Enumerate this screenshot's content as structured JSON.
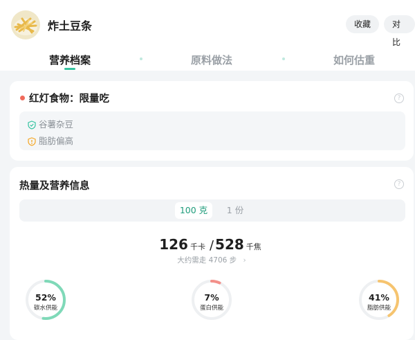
{
  "header": {
    "title": "炸土豆条",
    "actions": {
      "favorite": "收藏",
      "compare": "对比"
    }
  },
  "tabs": [
    {
      "label": "营养档案",
      "active": true
    },
    {
      "label": "原料做法",
      "active": false
    },
    {
      "label": "如何估重",
      "active": false
    }
  ],
  "rating": {
    "title": "红灯食物：限量吃",
    "color": "#f06a5b",
    "tags": [
      {
        "text": "谷薯杂豆",
        "icon": "shield-check-icon",
        "color": "#35c3a0"
      },
      {
        "text": "脂肪偏高",
        "icon": "shield-alert-icon",
        "color": "#f5a623"
      }
    ]
  },
  "nutrition": {
    "title": "热量及营养信息",
    "portions": [
      "100 克",
      "1 份"
    ],
    "selected_portion": "100 克",
    "kcal_value": "126",
    "kcal_unit": "千卡",
    "separator": "/",
    "kj_value": "528",
    "kj_unit": "千焦",
    "walk_text": "大约需走 4706 步",
    "macros": [
      {
        "pct": "52%",
        "value": 0.52,
        "label": "碳水供能",
        "color": "#7fd9b8"
      },
      {
        "pct": "7%",
        "value": 0.07,
        "label": "蛋白供能",
        "color": "#f3908a"
      },
      {
        "pct": "41%",
        "value": 0.41,
        "label": "脂肪供能",
        "color": "#f6c46f"
      }
    ]
  }
}
